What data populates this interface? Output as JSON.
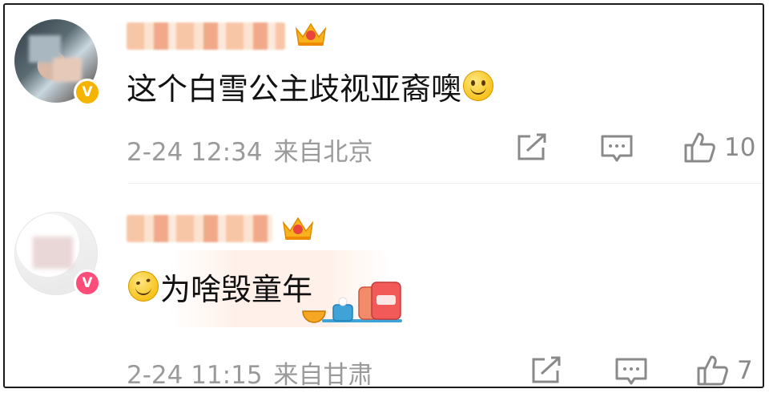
{
  "comments": [
    {
      "text": "这个白雪公主歧视亚裔噢",
      "emoji": "smile-emoji",
      "time": "2-24 12:34",
      "location": "来自北京",
      "likes": "10",
      "verified_badge": "V",
      "badge_color": "#f5b400"
    },
    {
      "text": "为啥毁童年",
      "emoji": "pained-smile-emoji",
      "time": "2-24 11:15",
      "location": "来自甘肃",
      "likes": "7",
      "verified_badge": "V",
      "badge_color": "#ff4d7a"
    }
  ],
  "icons": {
    "share": "share-icon",
    "comment": "comment-icon",
    "like": "thumbs-up-icon",
    "crown": "crown-badge-icon"
  }
}
